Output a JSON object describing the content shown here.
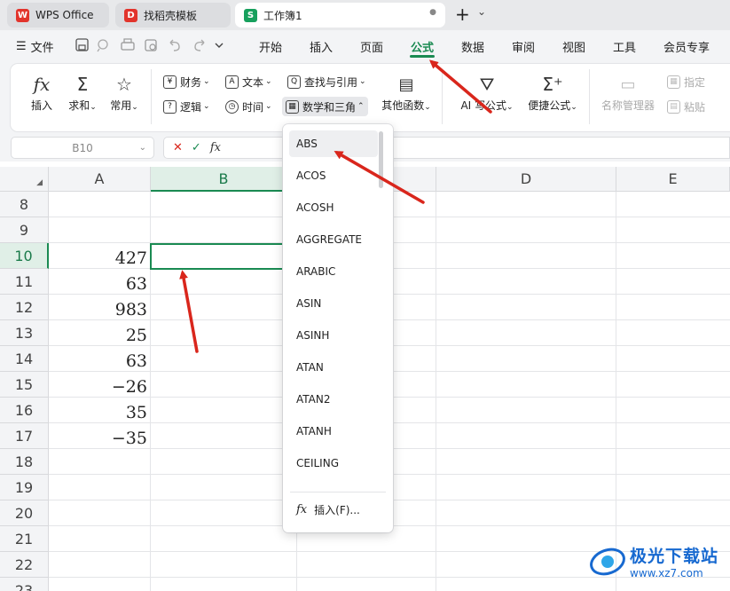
{
  "tabs": [
    {
      "label": "WPS Office",
      "icon": "wps-logo-icon",
      "color": "#e2342c"
    },
    {
      "label": "找稻壳模板",
      "icon": "docer-icon",
      "color": "#e2342c"
    },
    {
      "label": "工作簿1",
      "icon": "spreadsheet-s-icon",
      "color": "#17a05d",
      "active": true
    }
  ],
  "tabbar": {
    "new_tab": "+",
    "chevron": "⌄",
    "dot": "●"
  },
  "menu": {
    "file": "文件",
    "items": [
      "开始",
      "插入",
      "页面",
      "公式",
      "数据",
      "审阅",
      "视图",
      "工具",
      "会员专享"
    ],
    "active": "公式"
  },
  "ribbon": {
    "insert_function": "插入",
    "sum": "求和",
    "common": "常用",
    "finance": "财务",
    "text": "文本",
    "lookup": "查找与引用",
    "logic": "逻辑",
    "datetime": "时间",
    "math_trig": "数学和三角",
    "other_functions": "其他函数",
    "ai_formula": "AI 写公式",
    "quick_formula": "便捷公式",
    "name_manager": "名称管理器",
    "define": "指定",
    "paste": "粘贴"
  },
  "formula_bar": {
    "cell_ref": "B10",
    "fx": "fx",
    "cancel": "✕",
    "confirm": "✓",
    "content": ""
  },
  "columns": [
    "A",
    "B",
    "C",
    "D",
    "E"
  ],
  "rows": [
    {
      "num": "8",
      "a": ""
    },
    {
      "num": "9",
      "a": ""
    },
    {
      "num": "10",
      "a": "427"
    },
    {
      "num": "11",
      "a": "63"
    },
    {
      "num": "12",
      "a": "983"
    },
    {
      "num": "13",
      "a": "25"
    },
    {
      "num": "14",
      "a": "63"
    },
    {
      "num": "15",
      "a": "−26"
    },
    {
      "num": "16",
      "a": "35"
    },
    {
      "num": "17",
      "a": "−35"
    },
    {
      "num": "18",
      "a": ""
    },
    {
      "num": "19",
      "a": ""
    },
    {
      "num": "20",
      "a": ""
    },
    {
      "num": "21",
      "a": ""
    },
    {
      "num": "22",
      "a": ""
    },
    {
      "num": "23",
      "a": ""
    }
  ],
  "selected_cell": "B10",
  "dropdown": {
    "items": [
      "ABS",
      "ACOS",
      "ACOSH",
      "AGGREGATE",
      "ARABIC",
      "ASIN",
      "ASINH",
      "ATAN",
      "ATAN2",
      "ATANH",
      "CEILING"
    ],
    "hovered": "ABS",
    "insert_label": "插入(F)..."
  },
  "watermark": {
    "title": "极光下载站",
    "url": "www.xz7.com"
  },
  "colors": {
    "accent": "#1a8a52",
    "annotation_arrow": "#d9261c"
  }
}
